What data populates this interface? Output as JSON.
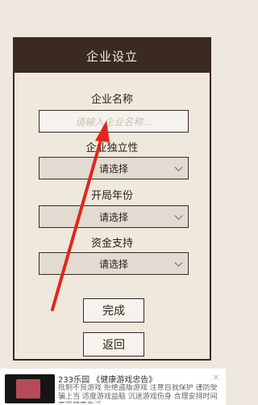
{
  "dialog": {
    "title": "企业设立",
    "company_name": {
      "label": "企业名称",
      "placeholder": "请输入企业名称..."
    },
    "independence": {
      "label": "企业独立性",
      "selected": "请选择"
    },
    "opening_year": {
      "label": "开局年份",
      "selected": "请选择"
    },
    "funding": {
      "label": "资金支持",
      "selected": "请选择"
    },
    "buttons": {
      "done": "完成",
      "back": "返回"
    }
  },
  "ad": {
    "source": "233乐园",
    "title": "《健康游戏忠告》",
    "body": "抵制不良游戏 拒绝盗版游戏 注意自我保护 谨防受骗上当 适度游戏益脑 沉迷游戏伤身 合理安排时间 享受健康生活",
    "close": "×"
  },
  "colors": {
    "background": "#efe8de",
    "header": "#3b2a22",
    "arrow": "#e0271d"
  }
}
